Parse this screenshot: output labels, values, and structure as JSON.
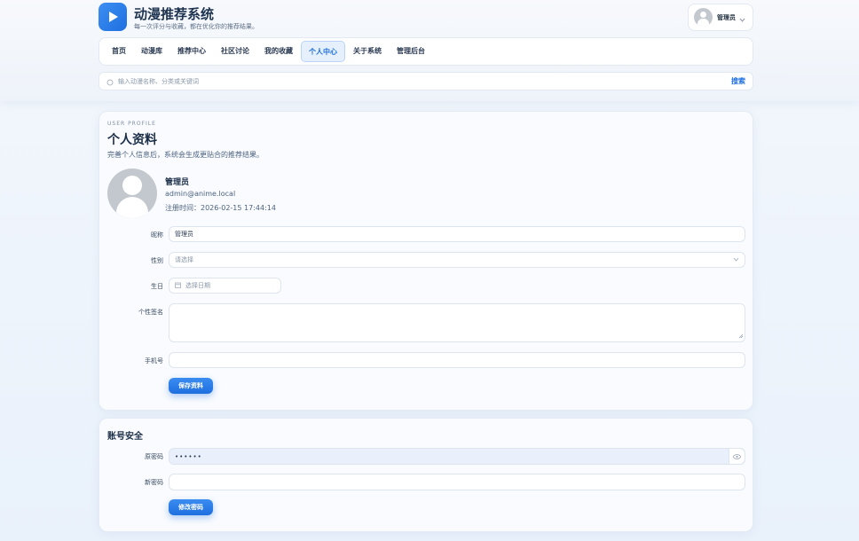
{
  "header": {
    "title": "动漫推荐系统",
    "subtitle": "每一次评分与收藏，都在优化你的推荐结果。",
    "user_name": "管理员"
  },
  "nav": {
    "items": [
      {
        "label": "首页",
        "active": false
      },
      {
        "label": "动漫库",
        "active": false
      },
      {
        "label": "推荐中心",
        "active": false
      },
      {
        "label": "社区讨论",
        "active": false
      },
      {
        "label": "我的收藏",
        "active": false
      },
      {
        "label": "个人中心",
        "active": true
      },
      {
        "label": "关于系统",
        "active": false
      },
      {
        "label": "管理后台",
        "active": false
      }
    ]
  },
  "search": {
    "placeholder": "输入动漫名称、分类或关键词",
    "button": "搜索"
  },
  "profile": {
    "eyebrow": "USER PROFILE",
    "title": "个人资料",
    "description": "完善个人信息后，系统会生成更贴合的推荐结果。",
    "name": "管理员",
    "email": "admin@anime.local",
    "registered": "注册时间：2026-02-15 17:44:14",
    "fields": {
      "nickname_label": "昵称",
      "nickname_value": "管理员",
      "gender_label": "性别",
      "gender_placeholder": "请选择",
      "birthday_label": "生日",
      "birthday_placeholder": "选择日期",
      "signature_label": "个性签名",
      "signature_value": "",
      "phone_label": "手机号",
      "phone_value": ""
    },
    "save_button": "保存资料"
  },
  "security": {
    "title": "账号安全",
    "old_password_label": "原密码",
    "old_password_value": "••••••",
    "new_password_label": "新密码",
    "new_password_value": "",
    "change_button": "修改密码"
  },
  "colors": {
    "primary": "#1e6fe0",
    "nav_active_bg": "#e6f0fd",
    "page_bg": "#eef3fa"
  }
}
